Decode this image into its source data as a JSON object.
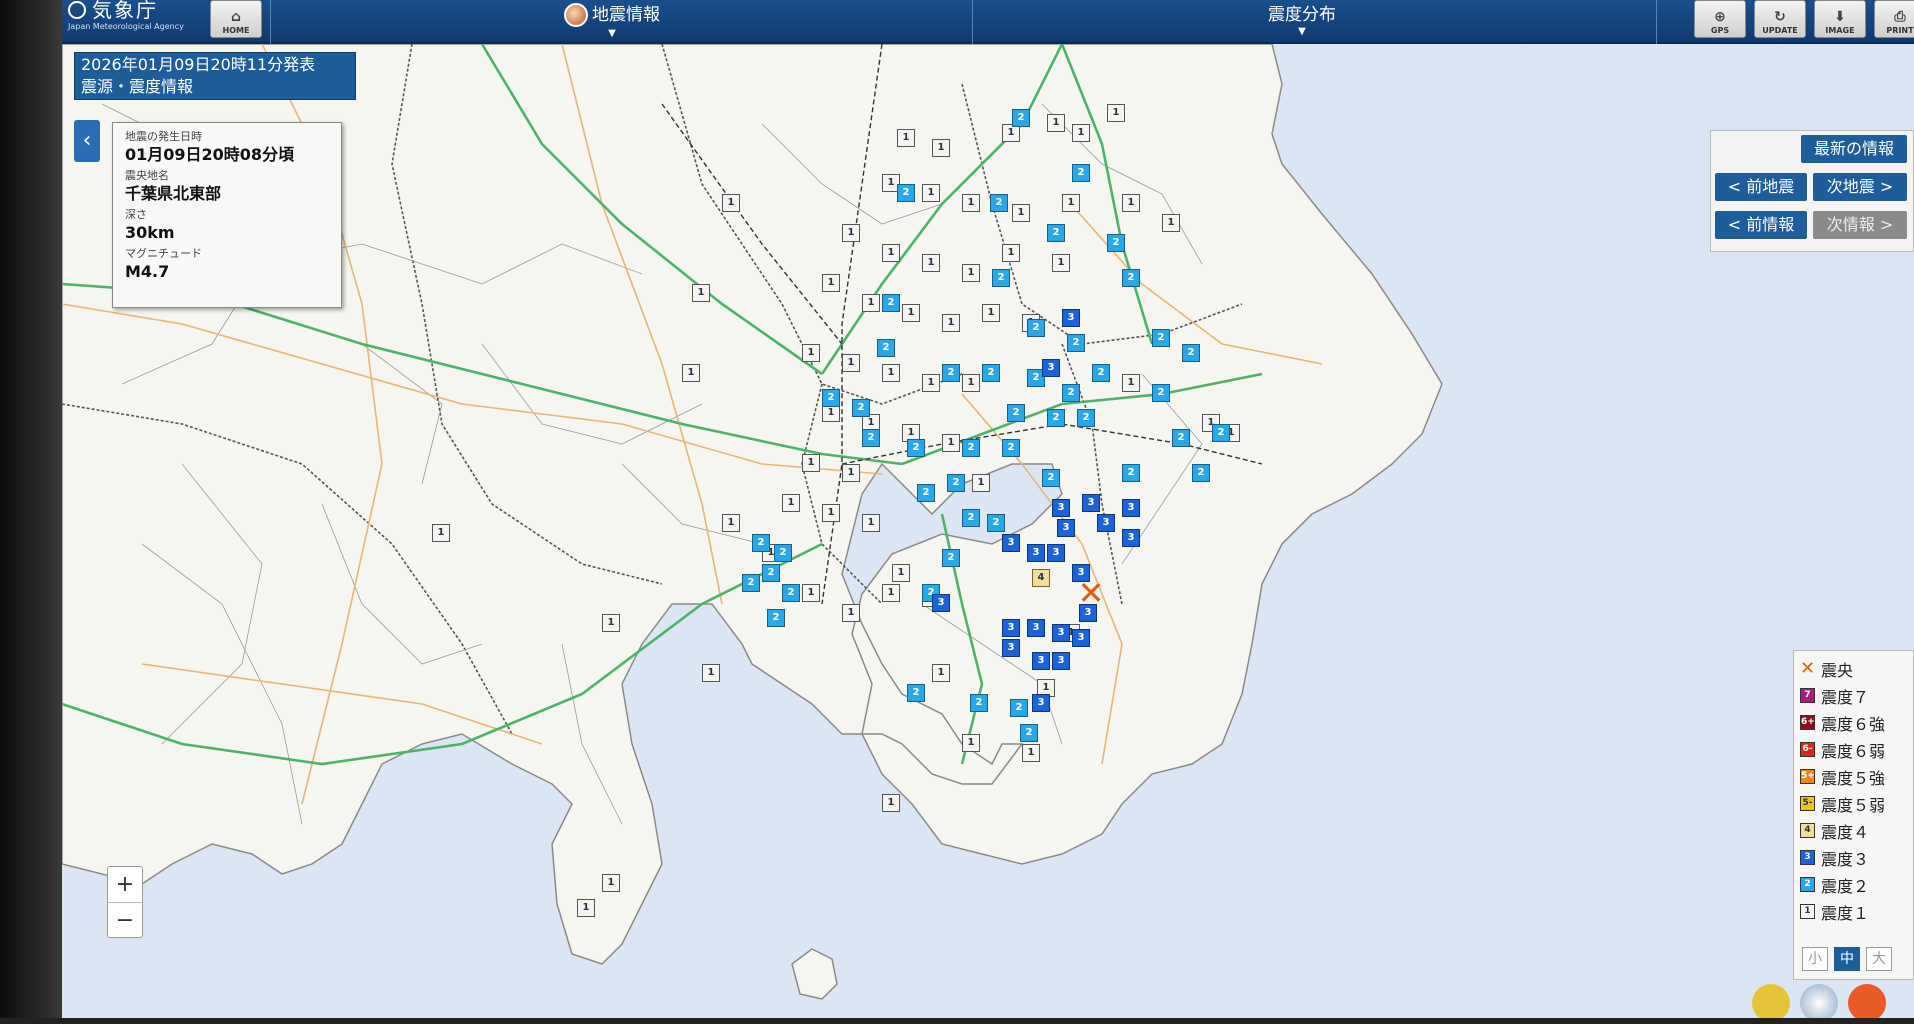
{
  "header": {
    "agency_name_jp": "気象庁",
    "agency_name_en": "Japan Meteorological Agency",
    "home_label": "HOME",
    "menu_quake_info": "地震情報",
    "menu_intensity_dist": "震度分布",
    "gps_label": "GPS",
    "update_label": "UPDATE",
    "image_label": "IMAGE",
    "print_label": "PRINT"
  },
  "issued": {
    "line1": "2026年01月09日20時11分発表",
    "line2": "震源・震度情報"
  },
  "quake": {
    "time_label": "地震の発生日時",
    "time_value": "01月09日20時08分頃",
    "epicenter_label": "震央地名",
    "epicenter_value": "千葉県北東部",
    "depth_label": "深さ",
    "depth_value": "30km",
    "magnitude_label": "マグニチュード",
    "magnitude_value": "M4.7"
  },
  "nav": {
    "latest": "最新の情報",
    "prev_quake": "< 前地震",
    "next_quake": "次地震 >",
    "prev_info": "< 前情報",
    "next_info": "次情報 >"
  },
  "legend": {
    "epicenter": "震央",
    "i7": "震度７",
    "i6p": "震度６強",
    "i6m": "震度６弱",
    "i5p": "震度５強",
    "i5m": "震度５弱",
    "i4": "震度４",
    "i3": "震度３",
    "i2": "震度２",
    "i1": "震度１",
    "sw7": "7",
    "sw6p": "6+",
    "sw6m": "6-",
    "sw5p": "5+",
    "sw5m": "5-",
    "sw4": "4",
    "sw3": "3",
    "sw2": "2",
    "sw1": "1",
    "size_small": "小",
    "size_medium": "中",
    "size_large": "大",
    "colors": {
      "i7": "#a0207a",
      "i6p": "#8a0f1e",
      "i6m": "#d42b1e",
      "i5p": "#e8891a",
      "i5m": "#e6c42a",
      "i4": "#f0dda0",
      "i3": "#1d62d6",
      "i2": "#29a7e6",
      "i1": "#f4f4f4"
    }
  },
  "zoom": {
    "in": "+",
    "out": "−"
  },
  "stations": {
    "intensity4": "4",
    "intensity3": "3",
    "intensity2": "2",
    "intensity1": "1"
  }
}
